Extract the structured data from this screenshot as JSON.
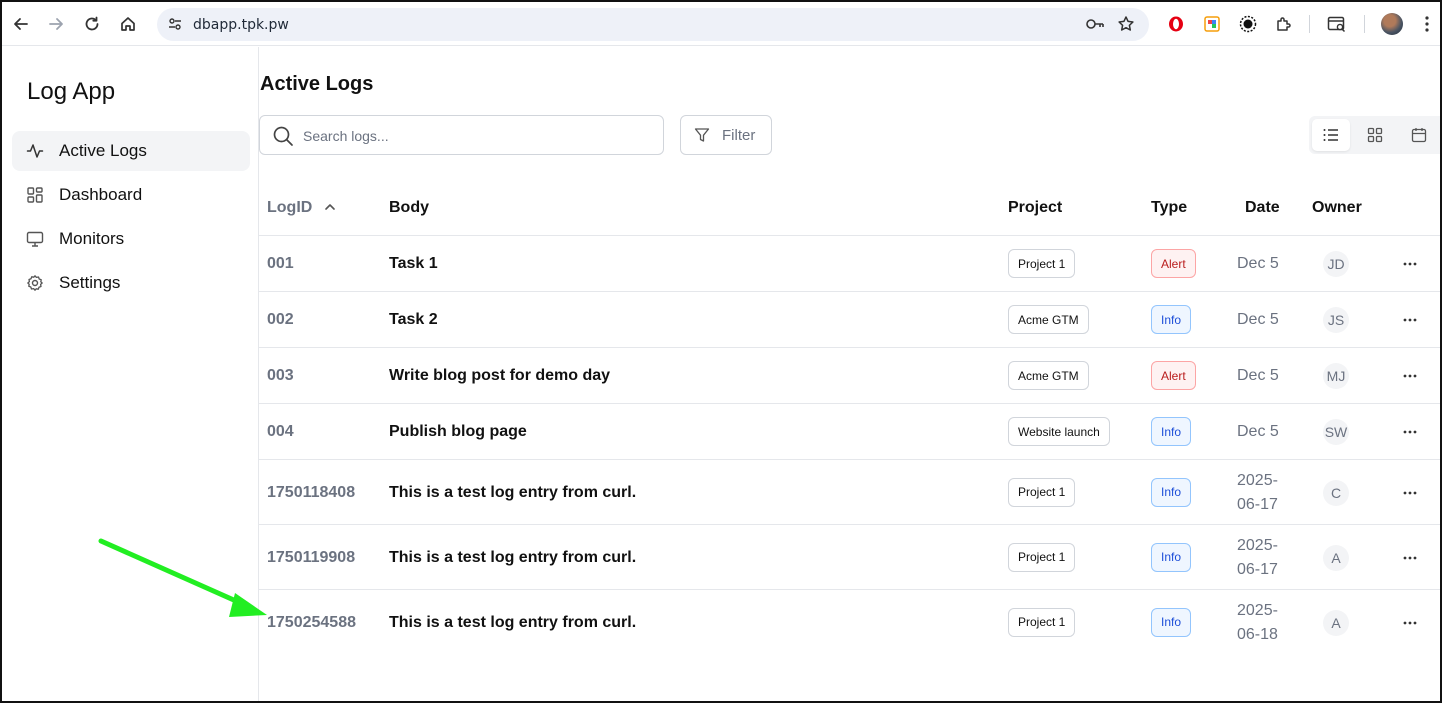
{
  "browser": {
    "url": "dbapp.tpk.pw"
  },
  "sidebar": {
    "app_title": "Log App",
    "items": [
      {
        "label": "Active Logs",
        "icon": "activity-icon"
      },
      {
        "label": "Dashboard",
        "icon": "dashboard-grid-icon"
      },
      {
        "label": "Monitors",
        "icon": "monitor-icon"
      },
      {
        "label": "Settings",
        "icon": "gear-icon"
      }
    ]
  },
  "main": {
    "title": "Active Logs",
    "search_placeholder": "Search logs...",
    "filter_label": "Filter",
    "views": [
      "list-view-icon",
      "grid-view-icon",
      "calendar-view-icon"
    ]
  },
  "table": {
    "columns": {
      "id": "LogID",
      "body": "Body",
      "project": "Project",
      "type": "Type",
      "date": "Date",
      "owner": "Owner"
    },
    "rows": [
      {
        "id": "001",
        "body": "Task 1",
        "project": "Project 1",
        "type": "Alert",
        "date": "Dec 5",
        "owner": "JD"
      },
      {
        "id": "002",
        "body": "Task 2",
        "project": "Acme GTM",
        "type": "Info",
        "date": "Dec 5",
        "owner": "JS"
      },
      {
        "id": "003",
        "body": "Write blog post for demo day",
        "project": "Acme GTM",
        "type": "Alert",
        "date": "Dec 5",
        "owner": "MJ"
      },
      {
        "id": "004",
        "body": "Publish blog page",
        "project": "Website launch",
        "type": "Info",
        "date": "Dec 5",
        "owner": "SW"
      },
      {
        "id": "1750118408",
        "body": "This is a test log entry from curl.",
        "project": "Project 1",
        "type": "Info",
        "date": "2025-06-17",
        "owner": "C"
      },
      {
        "id": "1750119908",
        "body": "This is a test log entry from curl.",
        "project": "Project 1",
        "type": "Info",
        "date": "2025-06-17",
        "owner": "A"
      },
      {
        "id": "1750254588",
        "body": "This is a test log entry from curl.",
        "project": "Project 1",
        "type": "Info",
        "date": "2025-06-18",
        "owner": "A"
      }
    ]
  },
  "colors": {
    "alert": "#b91c1c",
    "info": "#1d4ed8",
    "annotation_arrow": "#22ee22"
  }
}
